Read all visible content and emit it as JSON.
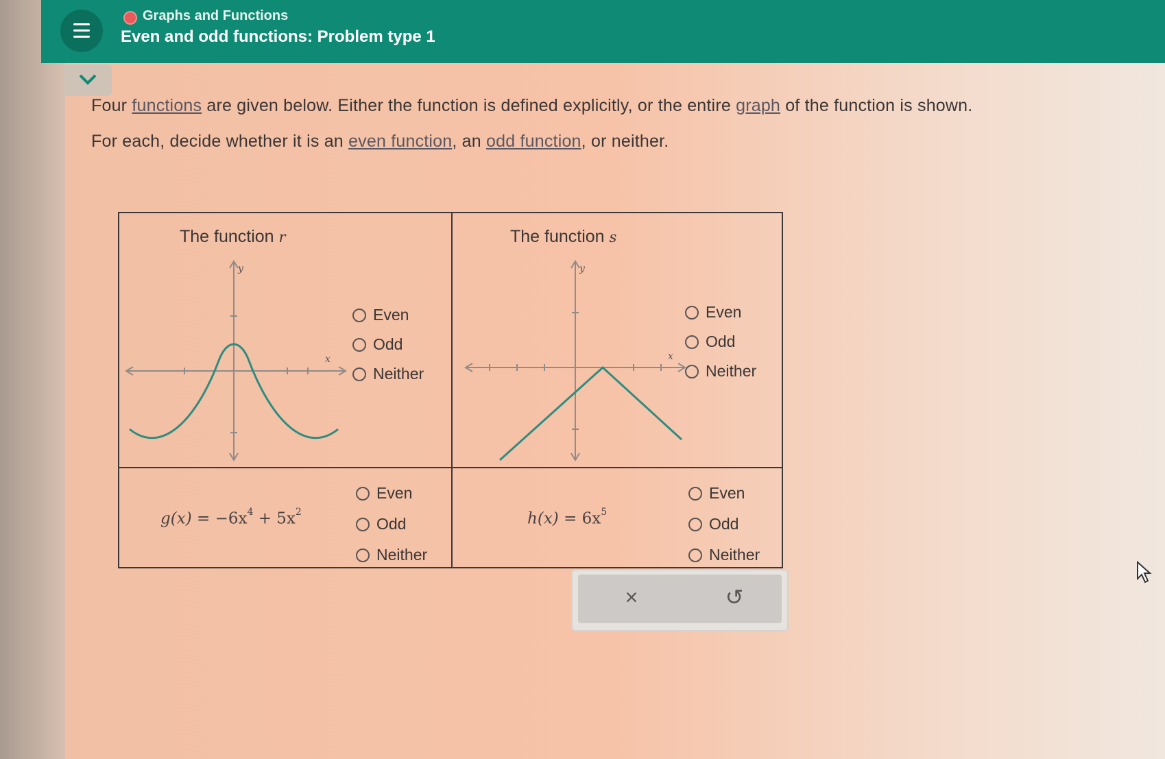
{
  "header": {
    "breadcrumb": "Graphs and Functions",
    "title": "Even and odd functions: Problem type 1"
  },
  "prompt": {
    "line1_a": "Four ",
    "line1_link": "functions",
    "line1_b": " are given below. Either the function is defined explicitly, or the entire ",
    "line1_link2": "graph",
    "line1_c": " of the function is shown.",
    "line2_a": "For each, decide whether it is an ",
    "line2_link": "even function",
    "line2_b": ", an ",
    "line2_link2": "odd function",
    "line2_c": ", or neither."
  },
  "cells": {
    "r": {
      "title": "The function",
      "name": "r"
    },
    "s": {
      "title": "The function",
      "name": "s"
    },
    "g": {
      "lhs": "g",
      "arg": "x",
      "eq": "= −6x",
      "p1": "4",
      "plus": "+ 5x",
      "p2": "2"
    },
    "h": {
      "lhs": "h",
      "arg": "x",
      "eq": "= 6x",
      "p1": "5"
    }
  },
  "options": {
    "even": "Even",
    "odd": "Odd",
    "neither": "Neither"
  },
  "axis": {
    "x": "x",
    "y": "y"
  },
  "actions": {
    "clear": "×",
    "undo": "↺"
  },
  "colors": {
    "header": "#0f8a74",
    "curve": "#2e8c80"
  }
}
